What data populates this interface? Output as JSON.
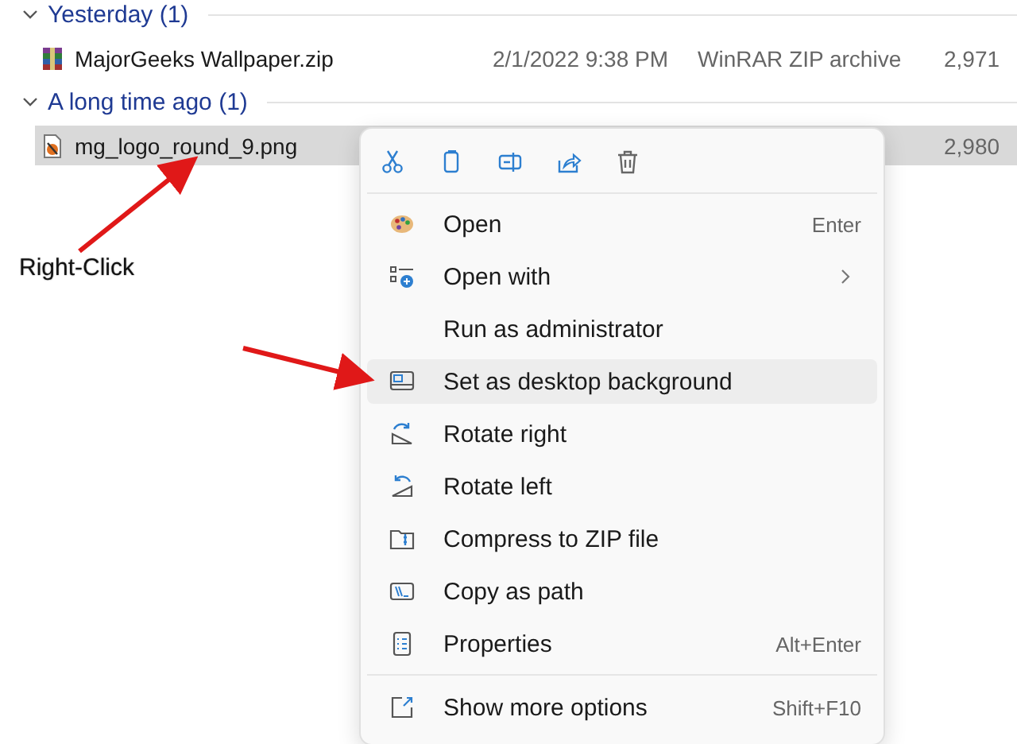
{
  "groups": [
    {
      "label": "Yesterday (1)",
      "expanded": true,
      "files": [
        {
          "name": "MajorGeeks Wallpaper.zip",
          "date": "2/1/2022 9:38 PM",
          "type": "WinRAR ZIP archive",
          "size": "2,971",
          "selected": false,
          "kind": "archive"
        }
      ]
    },
    {
      "label": "A long time ago (1)",
      "expanded": true,
      "files": [
        {
          "name": "mg_logo_round_9.png",
          "size": "2,980",
          "selected": true,
          "kind": "image"
        }
      ]
    }
  ],
  "context_menu": {
    "items": [
      {
        "label": "Open",
        "shortcut": "Enter",
        "submenu": false,
        "highlighted": false
      },
      {
        "label": "Open with",
        "submenu": true,
        "highlighted": false
      },
      {
        "label": "Run as administrator",
        "submenu": false,
        "highlighted": false
      },
      {
        "label": "Set as desktop background",
        "submenu": false,
        "highlighted": true
      },
      {
        "label": "Rotate right",
        "submenu": false,
        "highlighted": false
      },
      {
        "label": "Rotate left",
        "submenu": false,
        "highlighted": false
      },
      {
        "label": "Compress to ZIP file",
        "submenu": false,
        "highlighted": false
      },
      {
        "label": "Copy as path",
        "submenu": false,
        "highlighted": false
      },
      {
        "label": "Properties",
        "shortcut": "Alt+Enter",
        "submenu": false,
        "highlighted": false
      },
      {
        "label": "Show more options",
        "shortcut": "Shift+F10",
        "submenu": false,
        "highlighted": false,
        "separator_before": true
      }
    ]
  },
  "annotation": {
    "label": "Right-Click"
  }
}
